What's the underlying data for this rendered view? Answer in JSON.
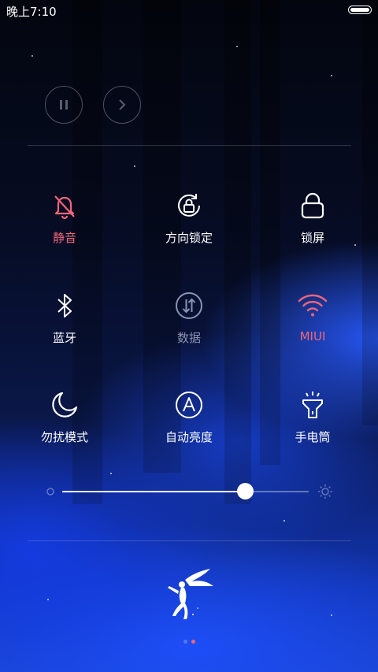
{
  "status_bar": {
    "time": "晚上7:10",
    "battery_level": 1.0
  },
  "media": {
    "pause_icon": "pause-icon",
    "next_icon": "next-icon"
  },
  "toggles": [
    {
      "id": "mute",
      "label": "静音",
      "icon": "bell-off-icon",
      "active": true
    },
    {
      "id": "rotation-lock",
      "label": "方向锁定",
      "icon": "rotation-lock-icon",
      "active": false
    },
    {
      "id": "lock-screen",
      "label": "锁屏",
      "icon": "lock-icon",
      "active": false
    },
    {
      "id": "bluetooth",
      "label": "蓝牙",
      "icon": "bluetooth-icon",
      "active": false
    },
    {
      "id": "mobile-data",
      "label": "数据",
      "icon": "data-arrows-icon",
      "active": false,
      "disabled": true
    },
    {
      "id": "wifi",
      "label": "MIUI",
      "icon": "wifi-icon",
      "active": true
    },
    {
      "id": "do-not-disturb",
      "label": "勿扰模式",
      "icon": "moon-icon",
      "active": false
    },
    {
      "id": "auto-brightness",
      "label": "自动亮度",
      "icon": "auto-brightness-icon",
      "active": false
    },
    {
      "id": "flashlight",
      "label": "手电筒",
      "icon": "flashlight-icon",
      "active": false
    }
  ],
  "brightness": {
    "value": 0.74,
    "low_icon": "brightness-low-icon",
    "high_icon": "brightness-high-icon"
  },
  "pager": {
    "pages": 2,
    "current": 2
  },
  "logo": "fairy-logo",
  "colors": {
    "active": "#f0667a",
    "inactive": "#ffffff",
    "disabled": "#8a93b2"
  }
}
